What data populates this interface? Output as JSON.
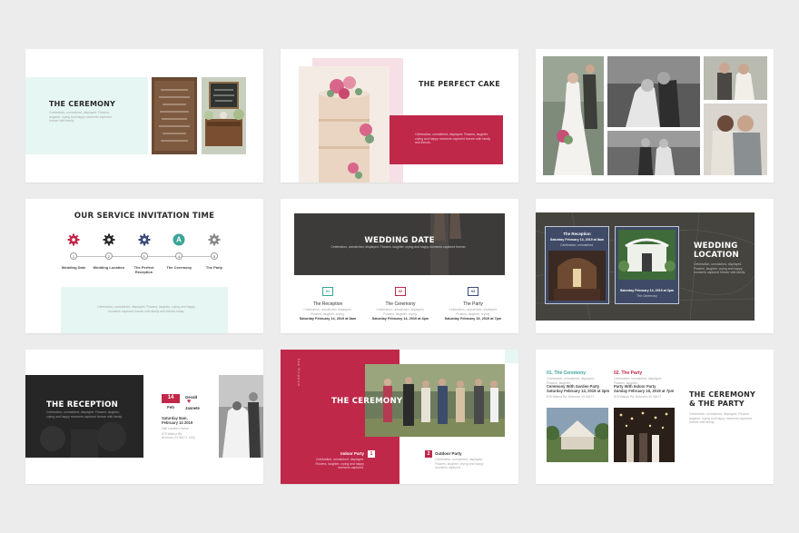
{
  "colors": {
    "crimson": "#c0284a",
    "mint": "#e6f6f2",
    "pink": "#f6dfe5",
    "teal": "#3aa497",
    "navy": "#3b4b7a",
    "dark": "#2a2a2a"
  },
  "slide1": {
    "title": "THE CEREMONY",
    "lorem": "Celebration, unmatched, displayed. Flowers, laughter, crying and happy moments captured forever with family."
  },
  "slide2": {
    "title": "THE PERFECT CAKE",
    "lorem": "Celebration, unmatched, displayed. Flowers, laughter, crying and happy moments captured forever with family and friends."
  },
  "slide4": {
    "title": "OUR SERVICE INVITATION TIME",
    "steps": [
      {
        "num": "1",
        "label": "Wedding Date",
        "icon": "gear-icon"
      },
      {
        "num": "2",
        "label": "Wedding Location",
        "icon": "gear-icon"
      },
      {
        "num": "3",
        "label": "The Perfect Reception",
        "icon": "gear-icon"
      },
      {
        "num": "4",
        "label": "The Ceremony",
        "icon": "letter-a-icon"
      },
      {
        "num": "5",
        "label": "The Party",
        "icon": "gear-icon"
      }
    ],
    "lorem": "Celebration, unmatched, displayed. Flowers, laughter, crying and happy moments captured forever with family and friends today."
  },
  "slide5": {
    "title": "WEDDING DATE",
    "banner_lorem": "Celebration, unmatched, displayed. Flowers, laughter, crying and happy moments captured forever.",
    "items": [
      {
        "num": "01",
        "title": "The Reception",
        "lorem": "Celebration, unmatched, displayed. Flowers, laughter, crying.",
        "date": "Saturday February 14, 2019 at 8am"
      },
      {
        "num": "02",
        "title": "The Ceremony",
        "lorem": "Celebration, unmatched, displayed. Flowers, laughter, crying.",
        "date": "Saturday February 14, 2019 at 3pm"
      },
      {
        "num": "03",
        "title": "The Party",
        "lorem": "Celebration, unmatched, displayed. Flowers, laughter, crying.",
        "date": "Saturday February 15, 2019 at 7pm"
      }
    ]
  },
  "slide6": {
    "card1_title": "The Reception",
    "card1_date": "Saturday February 14, 2019 at 8am",
    "card1_sub": "Celebration, unmatched.",
    "card2_date": "Saturday February 14, 2019 at 3pm",
    "card2_title": "The Ceremony",
    "title_line1": "WEDDING",
    "title_line2": "LOCATION",
    "lorem": "Celebration, unmatched, displayed. Flowers, laughter, crying and happy moments captured forever with family."
  },
  "slide7": {
    "title": "THE RECEPTION",
    "lorem": "Celebration, unmatched, displayed. Flowers, laughter, crying and happy moments captured forever with family.",
    "day": "14",
    "month": "Feb",
    "name1": "Gerald",
    "name2": "Jannete",
    "date_line1": "Saturday 8am,",
    "date_line2": "February 14 2019",
    "address1": "Hall Location Name",
    "address2": "878 Walnut Rd.",
    "address3": "Belmont, IN 06471, USA"
  },
  "slide8": {
    "title": "THE CEREMONY",
    "vertical_text": "wedding day",
    "item1_num": "1",
    "item1_title": "Indoor Party",
    "item1_lorem": "Celebration, unmatched, displayed. Flowers, laughter, crying and happy moments captured.",
    "item2_num": "2",
    "item2_title": "Outdoor Party",
    "item2_lorem": "Celebration, unmatched, displayed. Flowers, laughter, crying and happy moments captured."
  },
  "slide9": {
    "col1_title": "01. The Ceremony",
    "col1_lorem": "Celebration, unmatched, displayed. Flowers, laughter.",
    "col1_line1": "Ceremony With Garden Party",
    "col1_line2": "Saturday February 14, 2019 at 3pm",
    "col1_address": "878 Walnut Rd. Belmont, IN 06471",
    "col2_title": "02. The Party",
    "col2_lorem": "Celebration, unmatched, displayed. Flowers, laughter.",
    "col2_line1": "Party With Indoor Party",
    "col2_line2": "Sunday February 15, 2019 at 7pm",
    "col2_address": "878 Walnut Rd. Belmont, IN 06471",
    "title_line1": "THE CEREMONY",
    "title_line2": "& THE PARTY",
    "lorem": "Celebration, unmatched, displayed. Flowers, laughter, crying and happy moments captured forever with family."
  }
}
